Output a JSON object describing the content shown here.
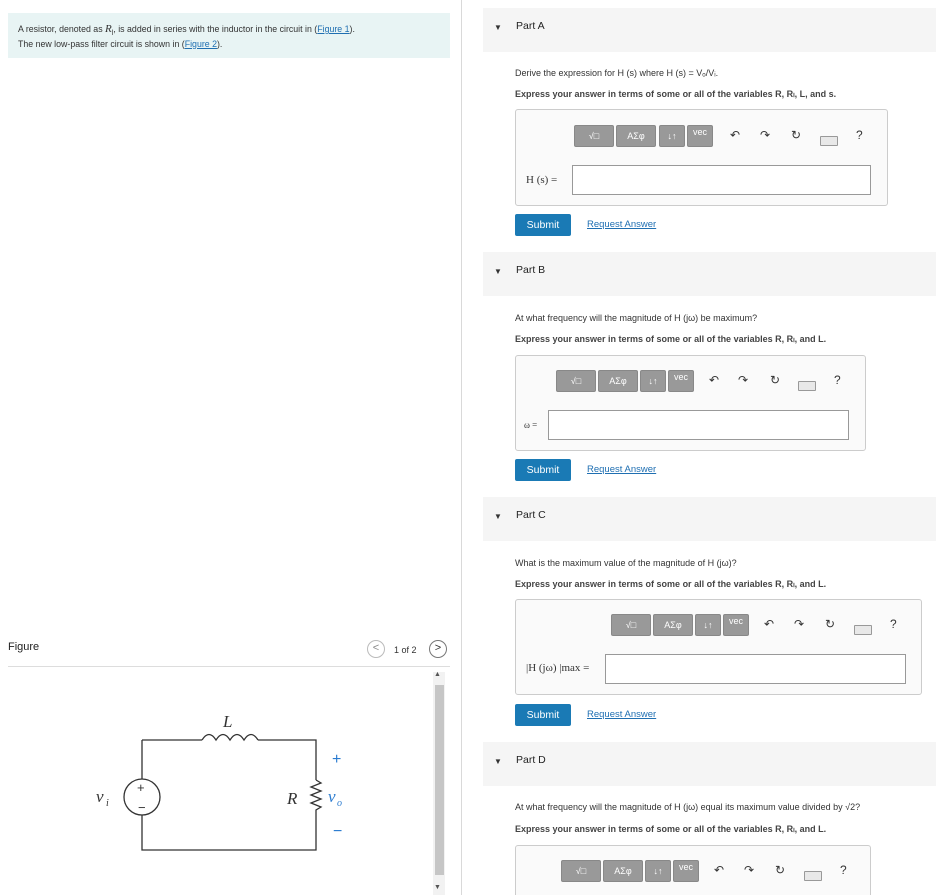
{
  "intro": {
    "line1_a": "A resistor, denoted as ",
    "line1_var": "R",
    "line1_sub": "l",
    "line1_b": ", is added in series with the inductor in the circuit in (",
    "link1": "Figure 1",
    "line1_c": ").",
    "line2_a": "The new low-pass filter circuit is shown in (",
    "link2": "Figure 2",
    "line2_b": ")."
  },
  "figure": {
    "label": "Figure",
    "pager_prev": "<",
    "pager_next": ">",
    "pager_count": "1 of 2",
    "circuit": {
      "inductor": "L",
      "resistor": "R",
      "source": "v",
      "source_sub": "i",
      "output": "v",
      "output_sub": "o",
      "plus": "+",
      "minus": "−",
      "src_plus": "+",
      "src_minus": "−"
    }
  },
  "toolbar": {
    "templates": "√□",
    "greek": "ΑΣφ",
    "arrows": "↓↑",
    "vec": "vec",
    "undo": "↶",
    "redo": "↷",
    "reset": "↻",
    "help": "?"
  },
  "parts": [
    {
      "label": "Part A",
      "question": "Derive the expression for H (s) where H (s) = Vₒ/Vᵢ.",
      "instruction": "Express your answer in terms of some or all of the variables R, Rₗ, L, and s.",
      "eq_label": "H (s) =",
      "submit": "Submit",
      "request": "Request Answer"
    },
    {
      "label": "Part B",
      "question": "At what frequency will the magnitude of H (jω) be maximum?",
      "instruction": "Express your answer in terms of some or all of the variables R, Rₗ, and L.",
      "eq_label": "ω =",
      "submit": "Submit",
      "request": "Request Answer"
    },
    {
      "label": "Part C",
      "question": "What is the maximum value of the magnitude of H (jω)?",
      "instruction": "Express your answer in terms of some or all of the variables R, Rₗ, and L.",
      "eq_label": "|H (jω) |max =",
      "submit": "Submit",
      "request": "Request Answer"
    },
    {
      "label": "Part D",
      "question": "At what frequency will the magnitude of H (jω) equal its maximum value divided by √2?",
      "instruction": "Express your answer in terms of some or all of the variables R, Rₗ, and L."
    }
  ]
}
